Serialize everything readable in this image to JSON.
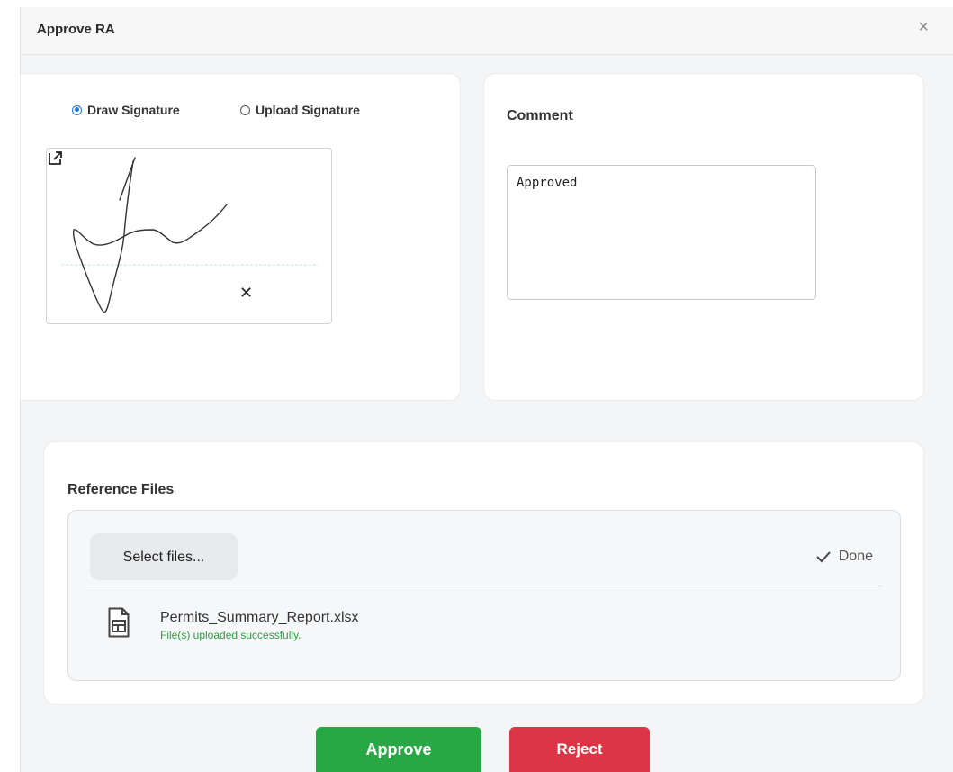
{
  "dialog": {
    "title": "Approve RA",
    "close_label": "×"
  },
  "signature": {
    "options": [
      {
        "label": "Draw Signature",
        "selected": true
      },
      {
        "label": "Upload Signature",
        "selected": false
      }
    ],
    "clear_label": "✕",
    "icons": {
      "expand": "open-external-icon",
      "clear": "clear-x-icon"
    }
  },
  "comment": {
    "label": "Comment",
    "value": "Approved"
  },
  "reference_files": {
    "label": "Reference Files",
    "select_label": "Select files...",
    "done_label": "Done",
    "files": [
      {
        "name": "Permits_Summary_Report.xlsx",
        "status": "File(s) uploaded successfully."
      }
    ]
  },
  "actions": {
    "approve_label": "Approve",
    "reject_label": "Reject"
  },
  "colors": {
    "approve": "#28a745",
    "reject": "#dc3545",
    "radio_selected": "#1a73e8",
    "success_text": "#2e9e44"
  }
}
